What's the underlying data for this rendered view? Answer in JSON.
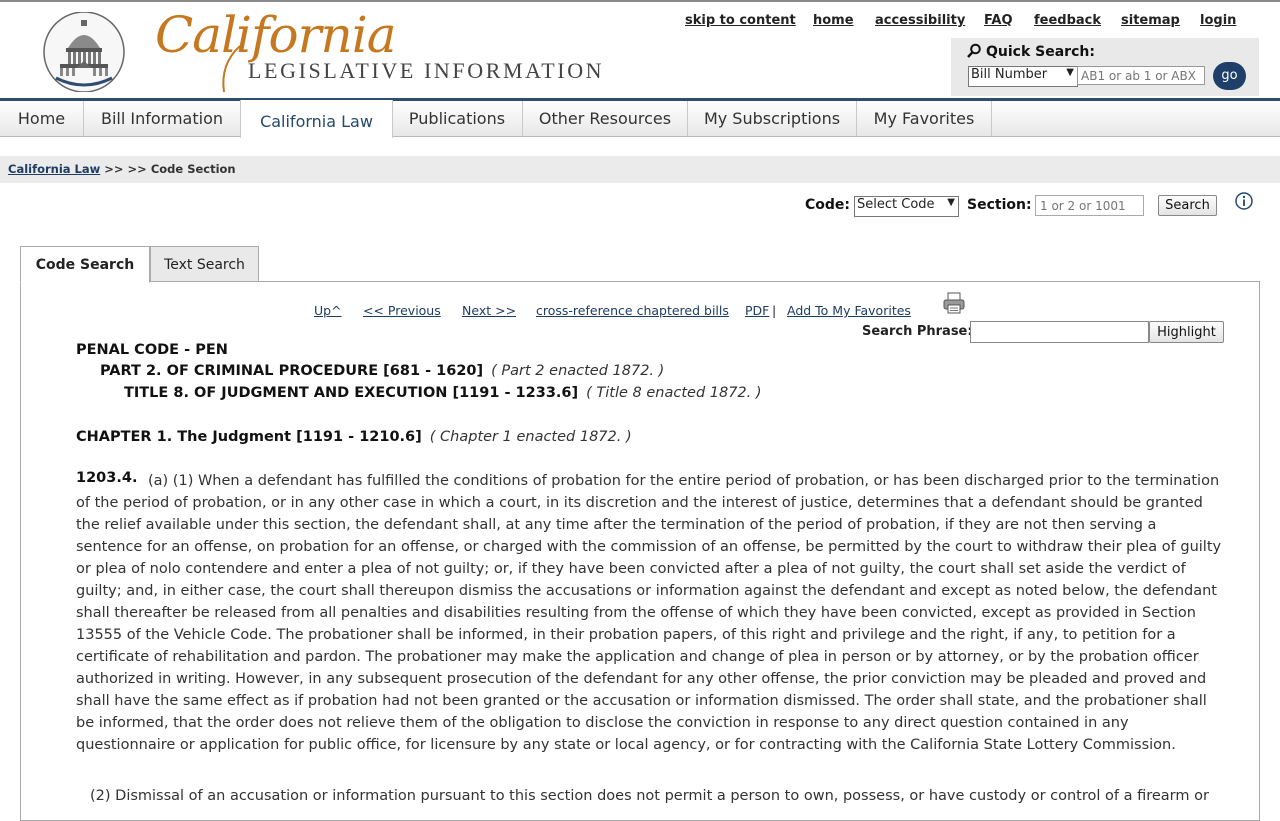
{
  "header": {
    "logo_script": "California",
    "logo_subtitle": "LEGISLATIVE INFORMATION",
    "utility_links": [
      "skip to content",
      "home",
      "accessibility",
      "FAQ",
      "feedback",
      "sitemap",
      "login"
    ]
  },
  "quick_search": {
    "title": "Quick Search:",
    "type_selected": "Bill Number",
    "placeholder": "AB1 or ab 1 or ABX",
    "go_label": "go"
  },
  "nav": {
    "items": [
      "Home",
      "Bill Information",
      "California Law",
      "Publications",
      "Other Resources",
      "My Subscriptions",
      "My Favorites"
    ],
    "active": "California Law"
  },
  "breadcrumb": {
    "link": "California Law",
    "rest": " >> >> Code Section"
  },
  "code_search": {
    "code_label": "Code:",
    "code_selected": "Select Code",
    "section_label": "Section:",
    "section_placeholder": "1 or 2 or 1001",
    "search_button": "Search"
  },
  "tabs": [
    "Code Search",
    "Text Search"
  ],
  "toolbar": {
    "up": "Up^",
    "previous": "<< Previous",
    "next": "Next >>",
    "cross_reference": "cross-reference chaptered bills",
    "pdf": "PDF",
    "pdf_sep": "|",
    "favorites": "Add To My Favorites",
    "search_phrase_label": "Search Phrase:",
    "highlight_button": "Highlight"
  },
  "law": {
    "code": "PENAL CODE - PEN",
    "part": "PART 2. OF CRIMINAL PROCEDURE [681 - 1620]",
    "part_note": "( Part 2 enacted 1872. )",
    "title": "TITLE 8. OF JUDGMENT AND EXECUTION [1191 - 1233.6]",
    "title_note": "( Title 8 enacted 1872. )",
    "chapter": "CHAPTER 1. The Judgment [1191 - 1210.6]",
    "chapter_note": "( Chapter 1 enacted 1872. )",
    "section_number": "1203.4.",
    "paragraph_a1": "(a) (1) When a defendant has fulfilled the conditions of probation for the entire period of probation, or has been discharged prior to the termination of the period of probation, or in any other case in which a court, in its discretion and the interest of justice, determines that a defendant should be granted the relief available under this section, the defendant shall, at any time after the termination of the period of probation, if they are not then serving a sentence for an offense, on probation for an offense, or charged with the commission of an offense, be permitted by the court to withdraw their plea of guilty or plea of nolo contendere and enter a plea of not guilty; or, if they have been convicted after a plea of not guilty, the court shall set aside the verdict of guilty; and, in either case, the court shall thereupon dismiss the accusations or information against the defendant and except as noted below, the defendant shall thereafter be released from all penalties and disabilities resulting from the offense of which they have been convicted, except as provided in Section 13555 of the Vehicle Code. The probationer shall be informed, in their probation papers, of this right and privilege and the right, if any, to petition for a certificate of rehabilitation and pardon. The probationer may make the application and change of plea in person or by attorney, or by the probation officer authorized in writing. However, in any subsequent prosecution of the defendant for any other offense, the prior conviction may be pleaded and proved and shall have the same effect as if probation had not been granted or the accusation or information dismissed. The order shall state, and the probationer shall be informed, that the order does not relieve them of the obligation to disclose the conviction in response to any direct question contained in any questionnaire or application for public office, for licensure by any state or local agency, or for contracting with the California State Lottery Commission.",
    "paragraph_a2": "(2) Dismissal of an accusation or information pursuant to this section does not permit a person to own, possess, or have custody or control of a firearm or"
  },
  "colors": {
    "brand_orange": "#c5781f",
    "nav_blue": "#24496f",
    "link_blue": "#1d3d63",
    "go_button": "#1f3f6b"
  }
}
